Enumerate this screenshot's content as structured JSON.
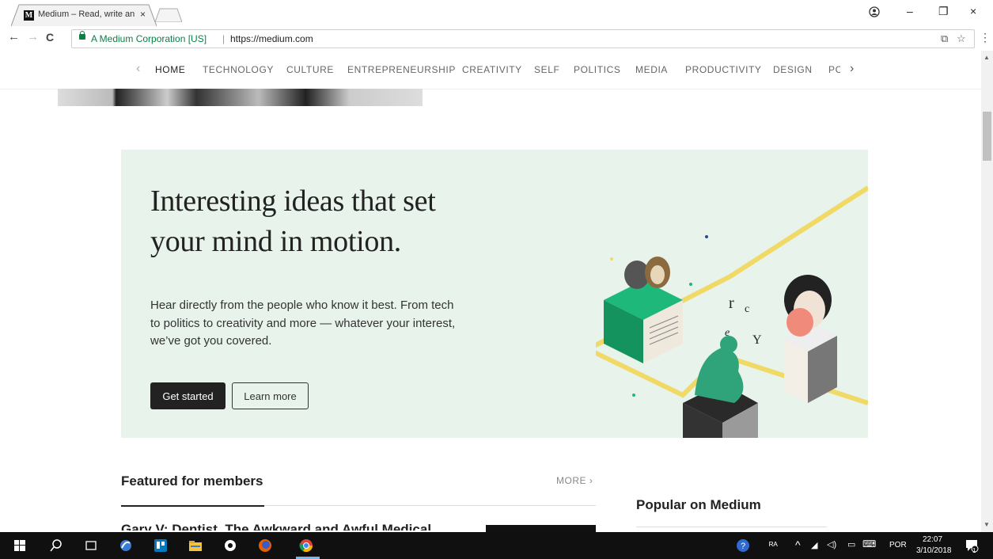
{
  "browser": {
    "tab": {
      "favicon": "M",
      "title": "Medium – Read, write an",
      "close": "×"
    },
    "window_controls": {
      "account_icon": "account-icon",
      "minimize": "–",
      "restore": "❐",
      "close": "×"
    },
    "nav": {
      "back": "←",
      "forward": "→",
      "reload": "C"
    },
    "address": {
      "org": "A Medium Corporation [US]",
      "separator": "|",
      "url": "https://medium.com"
    },
    "omnibox_icons": {
      "translate": "⧉",
      "bookmark": "☆",
      "menu": "⋮"
    }
  },
  "topic_nav": {
    "prev": "‹",
    "next": "›",
    "items": [
      "HOME",
      "TECHNOLOGY",
      "CULTURE",
      "ENTREPRENEURSHIP",
      "CREATIVITY",
      "SELF",
      "POLITICS",
      "MEDIA",
      "PRODUCTIVITY",
      "DESIGN",
      "PC"
    ],
    "active": "HOME"
  },
  "promo": {
    "heading": "Interesting ideas that set your mind in motion.",
    "body": "Hear directly from the people who know it best. From tech to politics to creativity and more — whatever your interest, we’ve got you covered.",
    "primary_button": "Get started",
    "secondary_button": "Learn more",
    "colors": {
      "background": "#e8f3ec",
      "accent_yellow": "#f0d964",
      "accent_green": "#1db87a",
      "accent_pink": "#f08a7a"
    }
  },
  "featured": {
    "title": "Featured for members",
    "more": "MORE ›",
    "first_article_partial": "Gary V: Dentist, The Awkward and Awful Medical"
  },
  "popular": {
    "title": "Popular on Medium"
  },
  "taskbar": {
    "language": "POR",
    "time": "22:07",
    "date": "3/10/2018",
    "notification_count": "1",
    "tray": "^"
  }
}
